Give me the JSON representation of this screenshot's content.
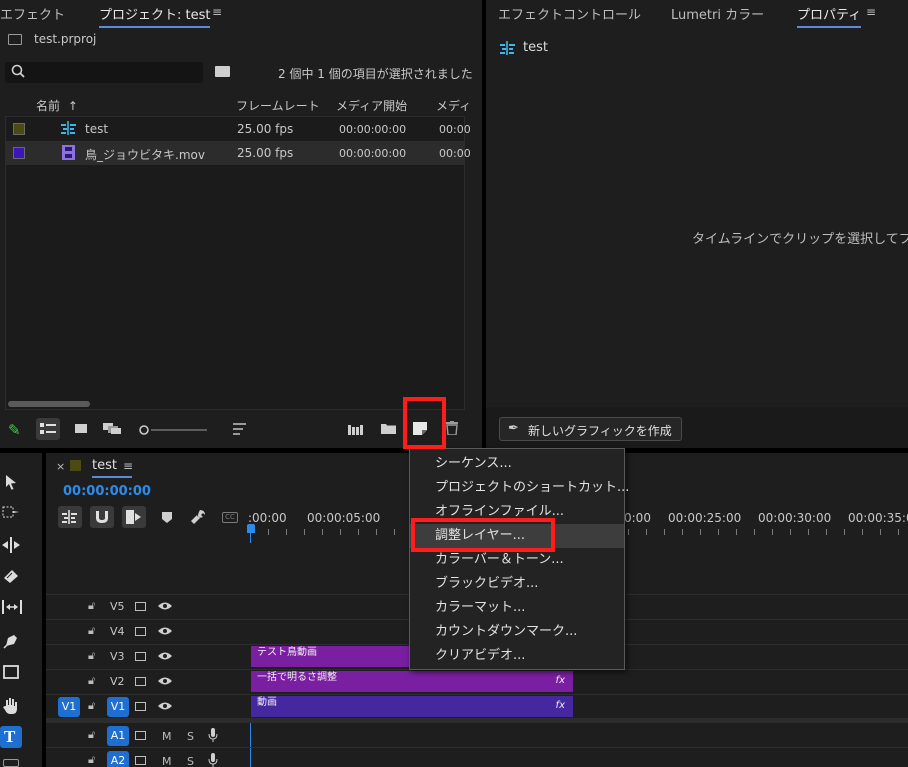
{
  "project_panel": {
    "tabs": [
      {
        "label": "エフェクト",
        "active": false
      },
      {
        "label": "プロジェクト: test",
        "active": true
      }
    ],
    "project_file": "test.prproj",
    "selection_status": "2 個中 1 個の項目が選択されました",
    "columns": [
      "名前",
      "フレームレート",
      "メディア開始",
      "メディ"
    ],
    "items": [
      {
        "name": "test",
        "frame_rate": "25.00 fps",
        "media_start": "00:00:00:00",
        "media_end": "00:00",
        "swatch_color": "#4a4a12",
        "icon": "sequence-icon"
      },
      {
        "name": "鳥_ジョウビタキ.mov",
        "frame_rate": "25.00 fps",
        "media_start": "00:00:00:00",
        "media_end": "00:00",
        "swatch_color": "#3b17b8",
        "icon": "film-icon"
      }
    ]
  },
  "right_panel": {
    "tabs": [
      {
        "label": "エフェクトコントロール",
        "active": false
      },
      {
        "label": "Lumetri カラー",
        "active": false
      },
      {
        "label": "プロパティ",
        "active": true
      }
    ],
    "sequence_name": "test",
    "hint_text": "タイムラインでクリップを選択してプロ",
    "new_graphic_label": "新しいグラフィックを作成"
  },
  "timeline": {
    "sequence_tab": "test",
    "timecode": "00:00:00:00",
    "ruler_ticks": [
      ":00:00",
      "00:00:05:00",
      "0:00",
      "00:00:25:00",
      "00:00:30:00",
      "00:00:35:0"
    ],
    "video_tracks": [
      "V5",
      "V4",
      "V3",
      "V2",
      "V1"
    ],
    "audio_tracks": [
      "A1",
      "A2"
    ],
    "source_patch": "V1",
    "clips": [
      {
        "track": "V3",
        "label": "テスト鳥動画",
        "color": "#7b1fa2"
      },
      {
        "track": "V2",
        "label": "一括で明るさ調整",
        "color": "#7b1fa2",
        "fx": "fx"
      },
      {
        "track": "V1",
        "label": "動画",
        "color": "#4527a0",
        "fx": "fx"
      }
    ],
    "audio_buttons": {
      "mute": "M",
      "solo": "S"
    }
  },
  "context_menu": {
    "items": [
      "シーケンス...",
      "プロジェクトのショートカット...",
      "オフラインファイル...",
      "調整レイヤー...",
      "カラーバー＆トーン...",
      "ブラックビデオ...",
      "カラーマット...",
      "カウントダウンマーク...",
      "クリアビデオ..."
    ],
    "highlighted_index": 3
  },
  "colors": {
    "accent_blue": "#1f6fd1",
    "highlight_red": "#ff1c1c",
    "timecode_blue": "#2d8ceb"
  }
}
